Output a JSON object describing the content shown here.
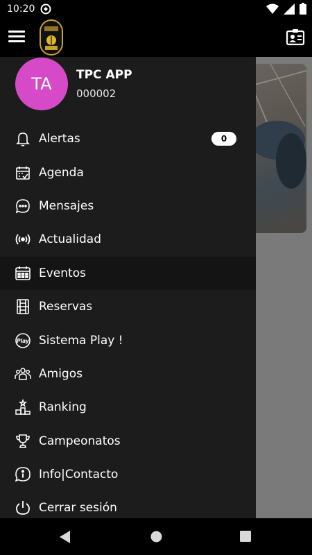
{
  "status_bar": {
    "time": "10:20"
  },
  "app_bar": {
    "logo_icon": "the-arena-logo",
    "menu_icon": "hamburger-icon",
    "card_icon": "id-card-icon"
  },
  "profile": {
    "initials": "TA",
    "name": "TPC APP",
    "id": "000002",
    "avatar_color": "#d64ac8"
  },
  "menu": {
    "items": [
      {
        "label": "Alertas",
        "icon": "bell-icon",
        "badge": "0"
      },
      {
        "label": "Agenda",
        "icon": "calendar-check-icon"
      },
      {
        "label": "Mensajes",
        "icon": "chat-bubble-icon"
      },
      {
        "label": "Actualidad",
        "icon": "broadcast-icon"
      },
      {
        "label": "Eventos",
        "icon": "calendar-grid-icon"
      },
      {
        "label": "Reservas",
        "icon": "court-icon"
      },
      {
        "label": "Sistema Play !",
        "icon": "play-badge-icon"
      },
      {
        "label": "Amigos",
        "icon": "group-icon"
      },
      {
        "label": "Ranking",
        "icon": "podium-icon"
      },
      {
        "label": "Campeonatos",
        "icon": "trophy-icon"
      },
      {
        "label": "Info|Contacto",
        "icon": "info-icon"
      },
      {
        "label": "Cerrar sesión",
        "icon": "power-icon"
      }
    ]
  },
  "colors": {
    "drawer_bg": "#1c1c1c",
    "active_item_bg": "#141414",
    "accent": "#d64ac8"
  }
}
